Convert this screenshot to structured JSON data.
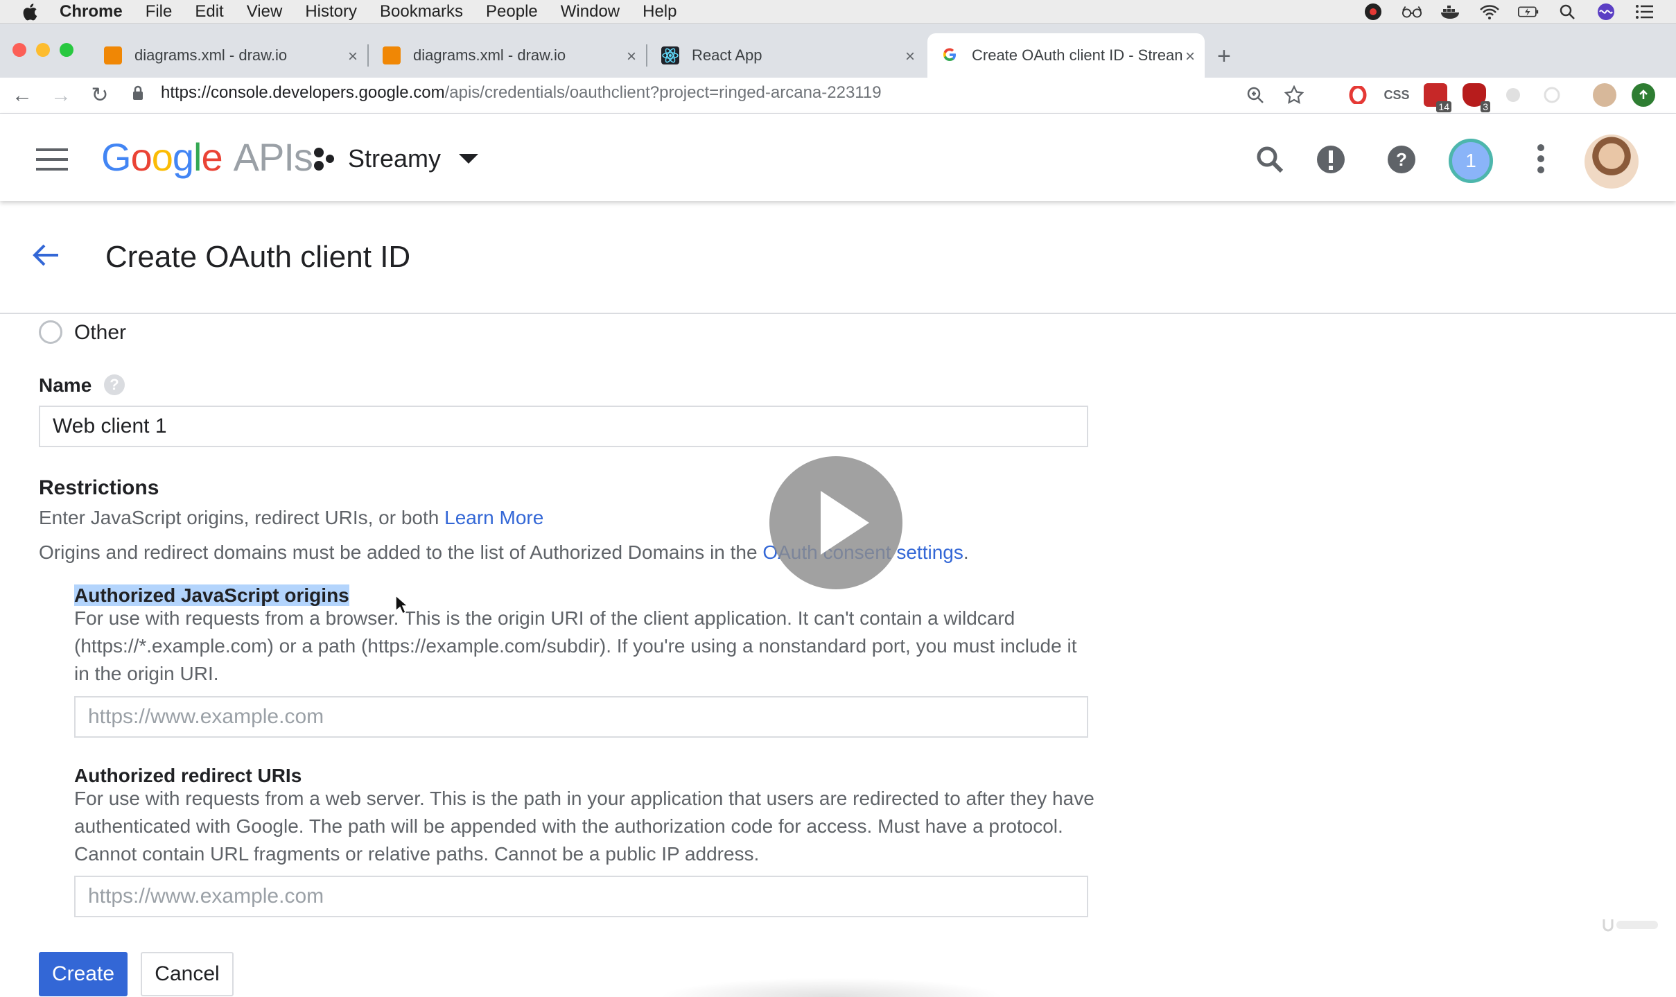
{
  "menubar": {
    "app": "Chrome",
    "items": [
      "File",
      "Edit",
      "View",
      "History",
      "Bookmarks",
      "People",
      "Window",
      "Help"
    ]
  },
  "tabs": [
    {
      "title": "diagrams.xml - draw.io",
      "icon": "drawio-icon"
    },
    {
      "title": "diagrams.xml - draw.io",
      "icon": "drawio-icon"
    },
    {
      "title": "React App",
      "icon": "react-icon"
    },
    {
      "title": "Create OAuth client ID - Strean",
      "icon": "google-icon",
      "active": true
    }
  ],
  "omnibox": {
    "url_host": "https://console.developers.google.com",
    "url_path": "/apis/credentials/oauthclient?project=ringed-arcana-223119"
  },
  "extensions": {
    "badge_1": "14",
    "badge_2": "3",
    "css_label": "CSS"
  },
  "header": {
    "logo_google": "Google",
    "logo_apis": "APIs",
    "project_name": "Streamy",
    "notification_count": "1"
  },
  "page": {
    "title": "Create OAuth client ID"
  },
  "form": {
    "radio_other": "Other",
    "name_label": "Name",
    "name_value": "Web client 1",
    "restrictions_heading": "Restrictions",
    "restrictions_text": "Enter JavaScript origins, redirect URIs, or both",
    "learn_more": "Learn More",
    "domains_text": "Origins and redirect domains must be added to the list of Authorized Domains in the",
    "consent_link": "OAuth consent settings",
    "period": ".",
    "origins_heading": "Authorized JavaScript origins",
    "origins_desc_1": "For use with requests from a browser. This is the origin URI of the client application. It can't contain a wildcard",
    "origins_desc_2": "(https://*.example.com) or a path (https://example.com/subdir). If you're using a nonstandard port, you must include it",
    "origins_desc_3": "in the origin URI.",
    "origins_placeholder": "https://www.example.com",
    "redirect_heading": "Authorized redirect URIs",
    "redirect_desc_1": "For use with requests from a web server. This is the path in your application that users are redirected to after they have",
    "redirect_desc_2": "authenticated with Google. The path will be appended with the authorization code for access. Must have a protocol.",
    "redirect_desc_3": "Cannot contain URL fragments or relative paths. Cannot be a public IP address.",
    "redirect_placeholder": "https://www.example.com",
    "create_button": "Create",
    "cancel_button": "Cancel"
  },
  "colors": {
    "accent": "#3367d6",
    "highlight": "#b3d4fc"
  }
}
